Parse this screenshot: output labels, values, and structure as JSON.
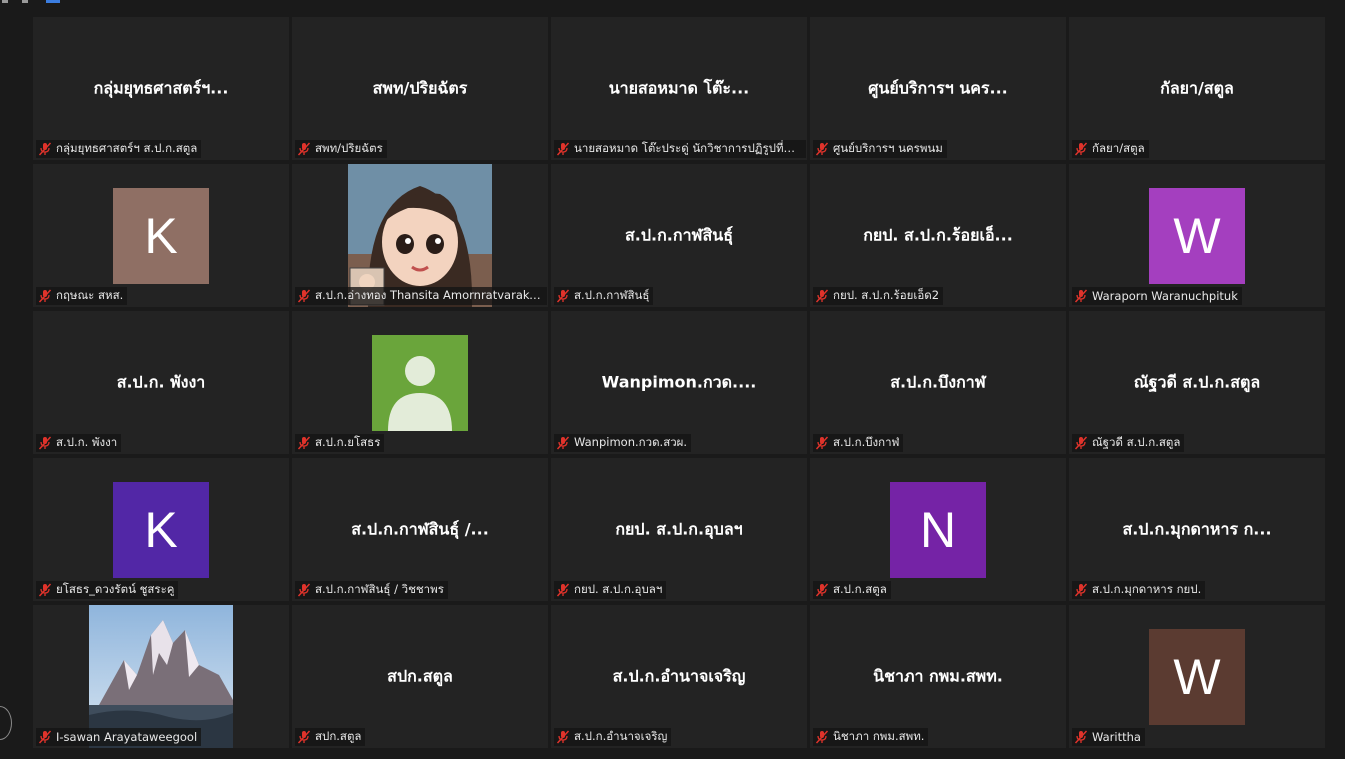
{
  "tiles": [
    {
      "name": "กลุ่มยุทธศาสตร์ฯ...",
      "label": "กลุ่มยุทธศาสตร์ฯ ส.ป.ก.สตูล"
    },
    {
      "name": "สพท/ปริยฉัตร",
      "label": "สพท/ปริยฉัตร"
    },
    {
      "name": "นายสอหมาด  โต๊ะ...",
      "label": "นายสอหมาด  โต๊ะประดู่ นักวิชาการปฏิรูปที่ดิน..."
    },
    {
      "name": "ศูนย์บริการฯ นคร...",
      "label": "ศูนย์บริการฯ นครพนม"
    },
    {
      "name": "กัลยา/สตูล",
      "label": "กัลยา/สตูล"
    },
    {
      "avatar_letter": "K",
      "avatar_color": "#8f6f64",
      "label": "กฤษณะ สหส."
    },
    {
      "photo": "cartoon-girl",
      "label": "ส.ป.ก.อ่างทอง Thansita Amornratvarakun"
    },
    {
      "name": "ส.ป.ก.กาฬสินธุ์",
      "label": "ส.ป.ก.กาฬสินธุ์"
    },
    {
      "name": "กยป. ส.ป.ก.ร้อยเอ็...",
      "label": "กยป. ส.ป.ก.ร้อยเอ็ด2"
    },
    {
      "avatar_letter": "W",
      "avatar_color": "#a43fbf",
      "label": "Waraporn Waranuchpituk"
    },
    {
      "name": "ส.ป.ก. พังงา",
      "label": "ส.ป.ก. พังงา"
    },
    {
      "photo": "generic-user",
      "label": "ส.ป.ก.ยโสธร"
    },
    {
      "name": "Wanpimon.กวด....",
      "label": "Wanpimon.กวด.สวผ."
    },
    {
      "name": "ส.ป.ก.บึงกาฬ",
      "label": "ส.ป.ก.บึงกาฬ"
    },
    {
      "name": "ณัฐวดี ส.ป.ก.สตูล",
      "label": "ณัฐวดี ส.ป.ก.สตูล"
    },
    {
      "avatar_letter": "K",
      "avatar_color": "#5227a6",
      "label": "ยโสธร_ดวงรัตน์ ชูสระคู"
    },
    {
      "name": "ส.ป.ก.กาฬสินธุ์ /...",
      "label": "ส.ป.ก.กาฬสินธุ์ / วิชชาพร"
    },
    {
      "name": "กยป. ส.ป.ก.อุบลฯ",
      "label": "กยป. ส.ป.ก.อุบลฯ"
    },
    {
      "avatar_letter": "N",
      "avatar_color": "#7523a6",
      "label": "ส.ป.ก.สตูล"
    },
    {
      "name": "ส.ป.ก.มุกดาหาร ก...",
      "label": "ส.ป.ก.มุกดาหาร กยป."
    },
    {
      "photo": "mountain",
      "label": "I-sawan Arayataweegool"
    },
    {
      "name": "สปก.สตูล",
      "label": "สปก.สตูล"
    },
    {
      "name": "ส.ป.ก.อำนาจเจริญ",
      "label": "ส.ป.ก.อำนาจเจริญ"
    },
    {
      "name": "นิชาภา กพม.สพท.",
      "label": "นิชาภา กพม.สพท."
    },
    {
      "avatar_letter": "W",
      "avatar_color": "#5b3b31",
      "label": "Warittha"
    }
  ],
  "icons": {
    "mute": "muted-microphone-icon",
    "accent": "#e0332b"
  }
}
